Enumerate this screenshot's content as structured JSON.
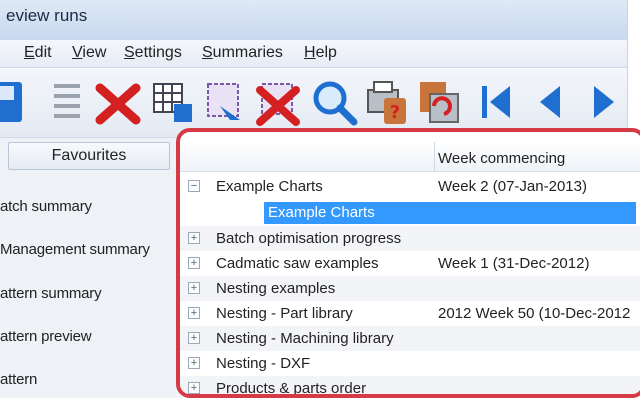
{
  "window": {
    "title": "eview runs"
  },
  "menu": [
    "Edit",
    "View",
    "Settings",
    "Summaries",
    "Help"
  ],
  "toolbar_icons": [
    "save-icon",
    "list-icon",
    "delete-icon",
    "grid-properties-icon",
    "edit-run-icon",
    "delete-run-icon",
    "search-icon",
    "printer-help-icon",
    "open-report-icon",
    "first-page-icon",
    "previous-icon",
    "next-icon"
  ],
  "sidebar": {
    "tab": "Favourites",
    "items": [
      "atch summary",
      "Management summary",
      "attern summary",
      "attern preview",
      "attern"
    ]
  },
  "tree": {
    "column_header": "Week commencing",
    "selected_child": "Example Charts",
    "rows": [
      {
        "label": "Example Charts",
        "week": "Week 2 (07-Jan-2013)",
        "expander": "−"
      },
      {
        "label": "Batch optimisation progress",
        "week": "",
        "expander": "+"
      },
      {
        "label": "Cadmatic saw examples",
        "week": "Week 1 (31-Dec-2012)",
        "expander": "+"
      },
      {
        "label": "Nesting examples",
        "week": "",
        "expander": "+"
      },
      {
        "label": "Nesting - Part library",
        "week": "2012 Week 50 (10-Dec-2012",
        "expander": "+"
      },
      {
        "label": "Nesting - Machining library",
        "week": "",
        "expander": "+"
      },
      {
        "label": "Nesting - DXF",
        "week": "",
        "expander": "+"
      },
      {
        "label": "Products & parts order",
        "week": "",
        "expander": "+"
      }
    ]
  },
  "colors": {
    "selection": "#3399ff",
    "panel_border": "#d63a47",
    "icon_blue": "#1e6fd0",
    "icon_red": "#d42020"
  }
}
